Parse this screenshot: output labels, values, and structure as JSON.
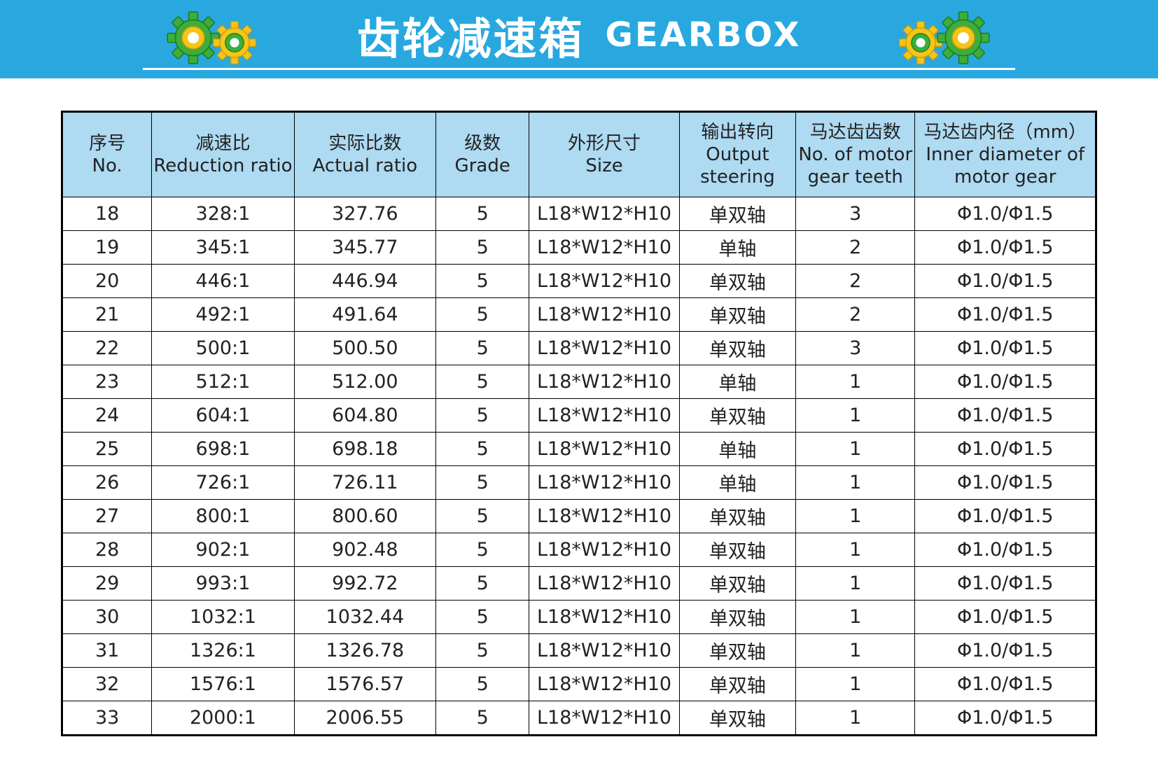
{
  "header": {
    "title_cn": "齿轮减速箱",
    "title_en": "GEARBOX"
  },
  "colors": {
    "banner": "#29a8e0",
    "header_cell": "#aedaf2",
    "gear_green": "#3cae3a",
    "gear_yellow": "#f5c518"
  },
  "icons": {
    "left_gears": [
      "green-gear-icon",
      "yellow-gear-icon"
    ],
    "right_gears": [
      "yellow-gear-icon",
      "green-gear-icon"
    ]
  },
  "table": {
    "columns": [
      {
        "lines": [
          "序号",
          "No."
        ]
      },
      {
        "lines": [
          "减速比",
          "Reduction ratio"
        ]
      },
      {
        "lines": [
          "实际比数",
          "Actual ratio"
        ]
      },
      {
        "lines": [
          "级数",
          "Grade"
        ]
      },
      {
        "lines": [
          "外形尺寸",
          "Size"
        ]
      },
      {
        "lines": [
          "输出转向",
          "Output",
          "steering"
        ]
      },
      {
        "lines": [
          "马达齿齿数",
          "No. of motor",
          "gear teeth"
        ]
      },
      {
        "lines": [
          "马达齿内径（mm）",
          "Inner diameter of",
          "motor gear"
        ]
      }
    ],
    "rows": [
      [
        "18",
        "328:1",
        "327.76",
        "5",
        "L18*W12*H10",
        "单双轴",
        "3",
        "Φ1.0/Φ1.5"
      ],
      [
        "19",
        "345:1",
        "345.77",
        "5",
        "L18*W12*H10",
        "单轴",
        "2",
        "Φ1.0/Φ1.5"
      ],
      [
        "20",
        "446:1",
        "446.94",
        "5",
        "L18*W12*H10",
        "单双轴",
        "2",
        "Φ1.0/Φ1.5"
      ],
      [
        "21",
        "492:1",
        "491.64",
        "5",
        "L18*W12*H10",
        "单双轴",
        "2",
        "Φ1.0/Φ1.5"
      ],
      [
        "22",
        "500:1",
        "500.50",
        "5",
        "L18*W12*H10",
        "单双轴",
        "3",
        "Φ1.0/Φ1.5"
      ],
      [
        "23",
        "512:1",
        "512.00",
        "5",
        "L18*W12*H10",
        "单轴",
        "1",
        "Φ1.0/Φ1.5"
      ],
      [
        "24",
        "604:1",
        "604.80",
        "5",
        "L18*W12*H10",
        "单双轴",
        "1",
        "Φ1.0/Φ1.5"
      ],
      [
        "25",
        "698:1",
        "698.18",
        "5",
        "L18*W12*H10",
        "单轴",
        "1",
        "Φ1.0/Φ1.5"
      ],
      [
        "26",
        "726:1",
        "726.11",
        "5",
        "L18*W12*H10",
        "单轴",
        "1",
        "Φ1.0/Φ1.5"
      ],
      [
        "27",
        "800:1",
        "800.60",
        "5",
        "L18*W12*H10",
        "单双轴",
        "1",
        "Φ1.0/Φ1.5"
      ],
      [
        "28",
        "902:1",
        "902.48",
        "5",
        "L18*W12*H10",
        "单双轴",
        "1",
        "Φ1.0/Φ1.5"
      ],
      [
        "29",
        "993:1",
        "992.72",
        "5",
        "L18*W12*H10",
        "单双轴",
        "1",
        "Φ1.0/Φ1.5"
      ],
      [
        "30",
        "1032:1",
        "1032.44",
        "5",
        "L18*W12*H10",
        "单双轴",
        "1",
        "Φ1.0/Φ1.5"
      ],
      [
        "31",
        "1326:1",
        "1326.78",
        "5",
        "L18*W12*H10",
        "单双轴",
        "1",
        "Φ1.0/Φ1.5"
      ],
      [
        "32",
        "1576:1",
        "1576.57",
        "5",
        "L18*W12*H10",
        "单双轴",
        "1",
        "Φ1.0/Φ1.5"
      ],
      [
        "33",
        "2000:1",
        "2006.55",
        "5",
        "L18*W12*H10",
        "单双轴",
        "1",
        "Φ1.0/Φ1.5"
      ]
    ]
  }
}
